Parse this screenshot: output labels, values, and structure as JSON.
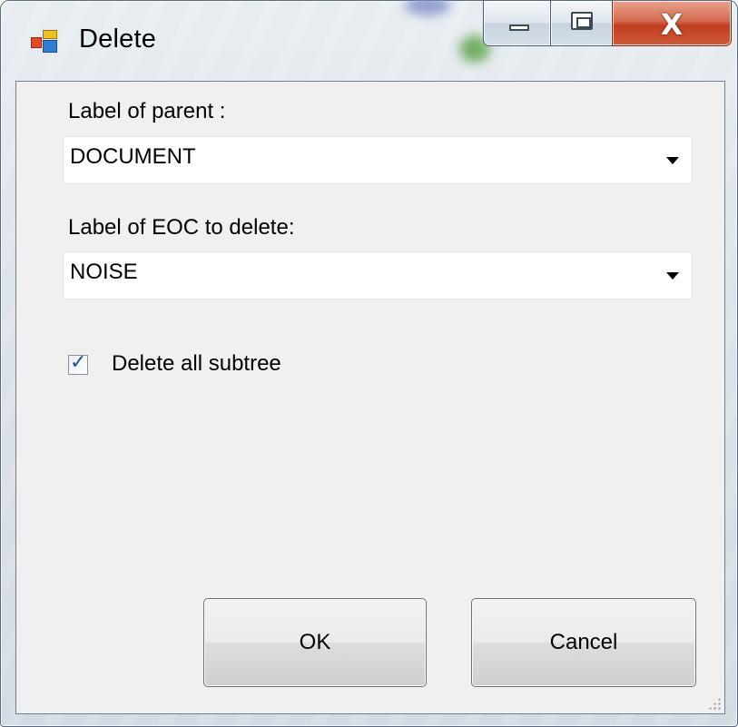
{
  "window": {
    "title": "Delete",
    "icon": "app-window-icon",
    "controls": {
      "minimize_icon": "minimize-icon",
      "maximize_icon": "maximize-icon",
      "close_glyph": "X"
    }
  },
  "form": {
    "parent_label": "Label of parent :",
    "parent_value": "DOCUMENT",
    "eoc_label": "Label of EOC to delete:",
    "eoc_value": "NOISE",
    "delete_subtree": {
      "label": "Delete all subtree",
      "checked": true
    }
  },
  "buttons": {
    "ok": "OK",
    "cancel": "Cancel"
  },
  "colors": {
    "client_bg": "#f0f0f0",
    "close_button": "#c8452a",
    "checkbox_check": "#2a4f9a"
  }
}
